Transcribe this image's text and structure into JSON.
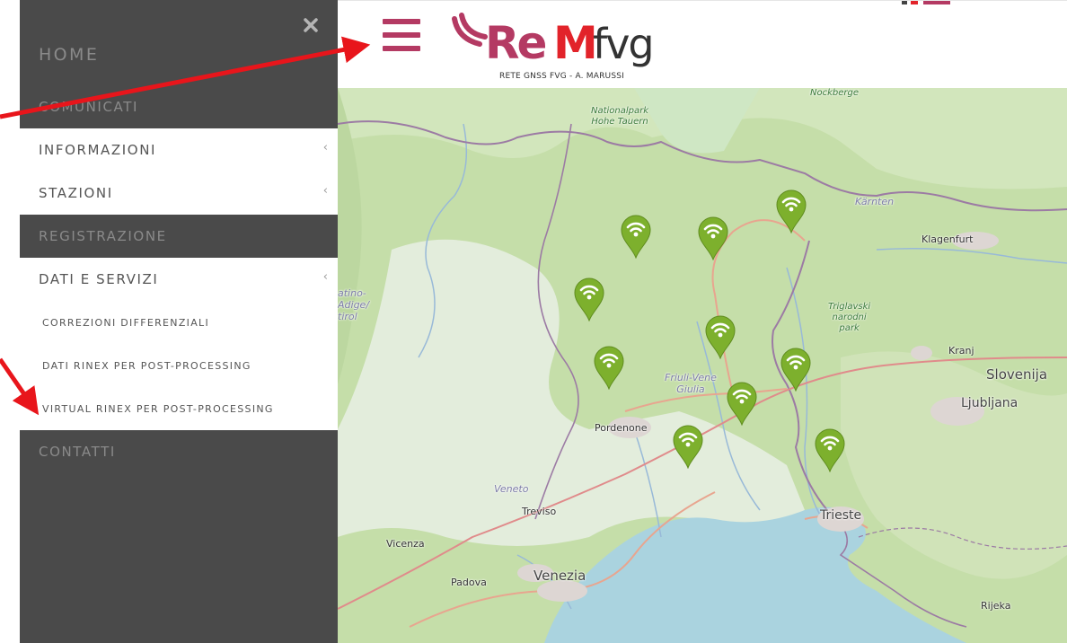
{
  "drawer": {
    "close_glyph": "×",
    "chevron_glyph": "‹",
    "items": {
      "home": "HOME",
      "comunicati": "COMUNICATI",
      "informazioni": "INFORMAZIONI",
      "stazioni": "STAZIONI",
      "registrazione": "REGISTRAZIONE",
      "dati_servizi": "DATI E SERVIZI",
      "contatti": "CONTATTI"
    },
    "submenu": {
      "correzioni": "CORREZIONI DIFFERENZIALI",
      "rinex": "DATI RINEX PER POST-PROCESSING",
      "virtual_rinex": "VIRTUAL RINEX PER POST-PROCESSING"
    }
  },
  "header": {
    "logo_text_re": "Re",
    "logo_text_m": "M",
    "logo_text_fvg": "fvg",
    "logo_subtitle": "RETE GNSS FVG - A. MARUSSI",
    "brand_colors": {
      "magenta": "#b43a63",
      "red": "#e2232a",
      "dark": "#333333"
    }
  },
  "map": {
    "labels": {
      "nockberge": "Nockberge",
      "nationalpark": "Nationalpark\nHohe Tauern",
      "karnten": "Kärnten",
      "klagenfurt": "Klagenfurt",
      "triglavski": "Triglavski\nnarodni\npark",
      "kranj": "Kranj",
      "slovenija": "Slovenija",
      "ljubljana": "Ljubljana",
      "alto_adige": "atino-\nAdige/\ntirol",
      "friuli": "Friuli-Vene\nGiulia",
      "pordenone": "Pordenone",
      "veneto": "Veneto",
      "treviso": "Treviso",
      "trieste": "Trieste",
      "vicenza": "Vicenza",
      "venezia": "Venezia",
      "padova": "Padova",
      "rijeka": "Rijeka"
    },
    "station_count": 10,
    "pin_color": "#7db02d"
  }
}
